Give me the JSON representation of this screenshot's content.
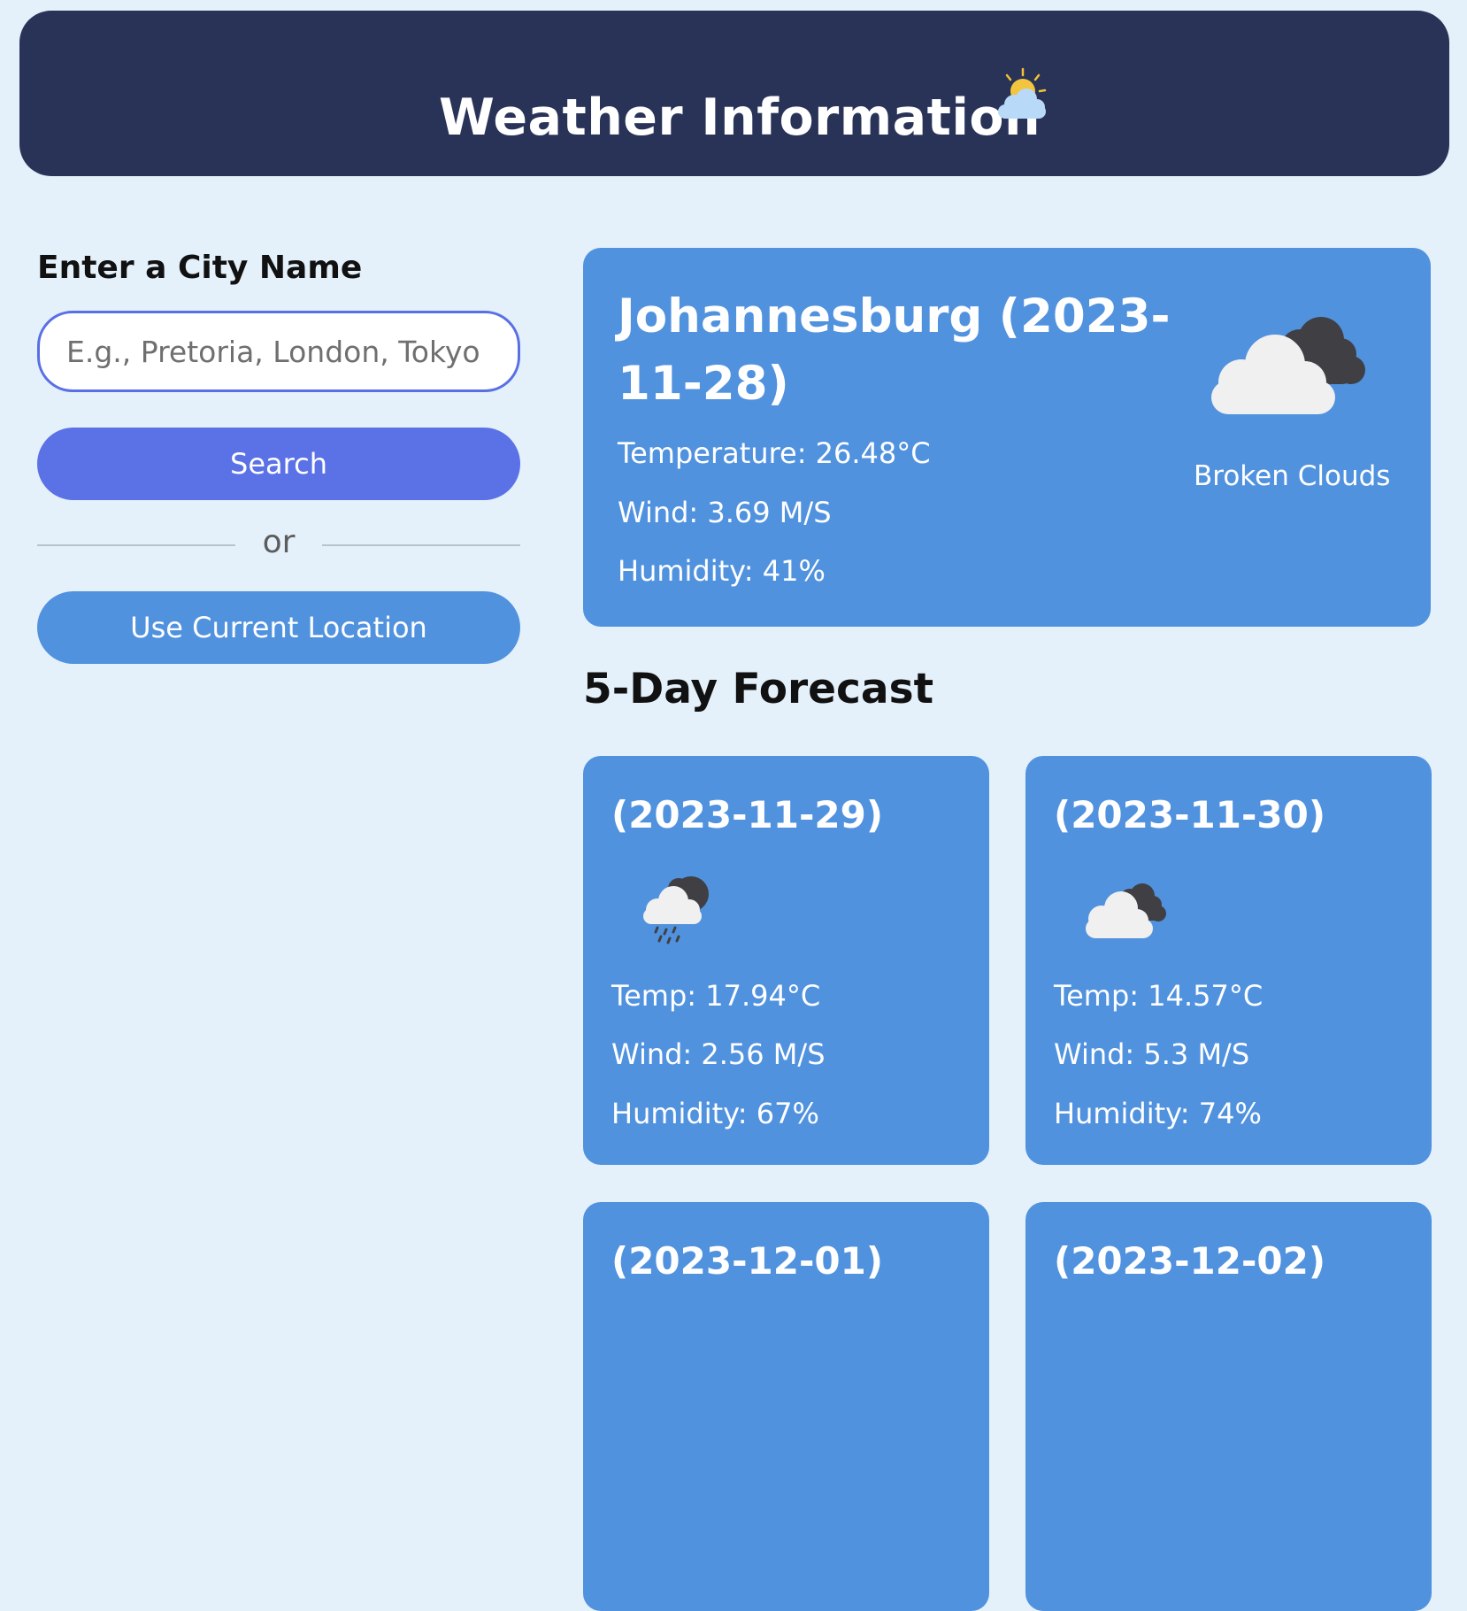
{
  "header": {
    "title": "Weather Information",
    "icon": "sun-behind-cloud-icon"
  },
  "search": {
    "label": "Enter a City Name",
    "placeholder": "E.g., Pretoria, London, Tokyo",
    "value": "",
    "search_button": "Search",
    "divider": "or",
    "location_button": "Use Current Location"
  },
  "current": {
    "title": "Johannesburg (2023-11-28)",
    "temperature": "Temperature: 26.48°C",
    "wind": "Wind: 3.69 M/S",
    "humidity": "Humidity: 41%",
    "description": "Broken Clouds",
    "icon": "broken-clouds-icon"
  },
  "forecast": {
    "heading": "5-Day Forecast",
    "days": [
      {
        "date": "(2023-11-29)",
        "icon": "rain-cloud-icon",
        "temp": "Temp: 17.94°C",
        "wind": "Wind: 2.56 M/S",
        "humidity": "Humidity: 67%"
      },
      {
        "date": "(2023-11-30)",
        "icon": "broken-clouds-icon",
        "temp": "Temp: 14.57°C",
        "wind": "Wind: 5.3 M/S",
        "humidity": "Humidity: 74%"
      },
      {
        "date": "(2023-12-01)"
      },
      {
        "date": "(2023-12-02)"
      }
    ]
  },
  "colors": {
    "page_background": "#e4f1fb",
    "header_background": "#293358",
    "card_background": "#5192df",
    "search_button": "#5b71e6",
    "input_border": "#5a6fe6"
  }
}
